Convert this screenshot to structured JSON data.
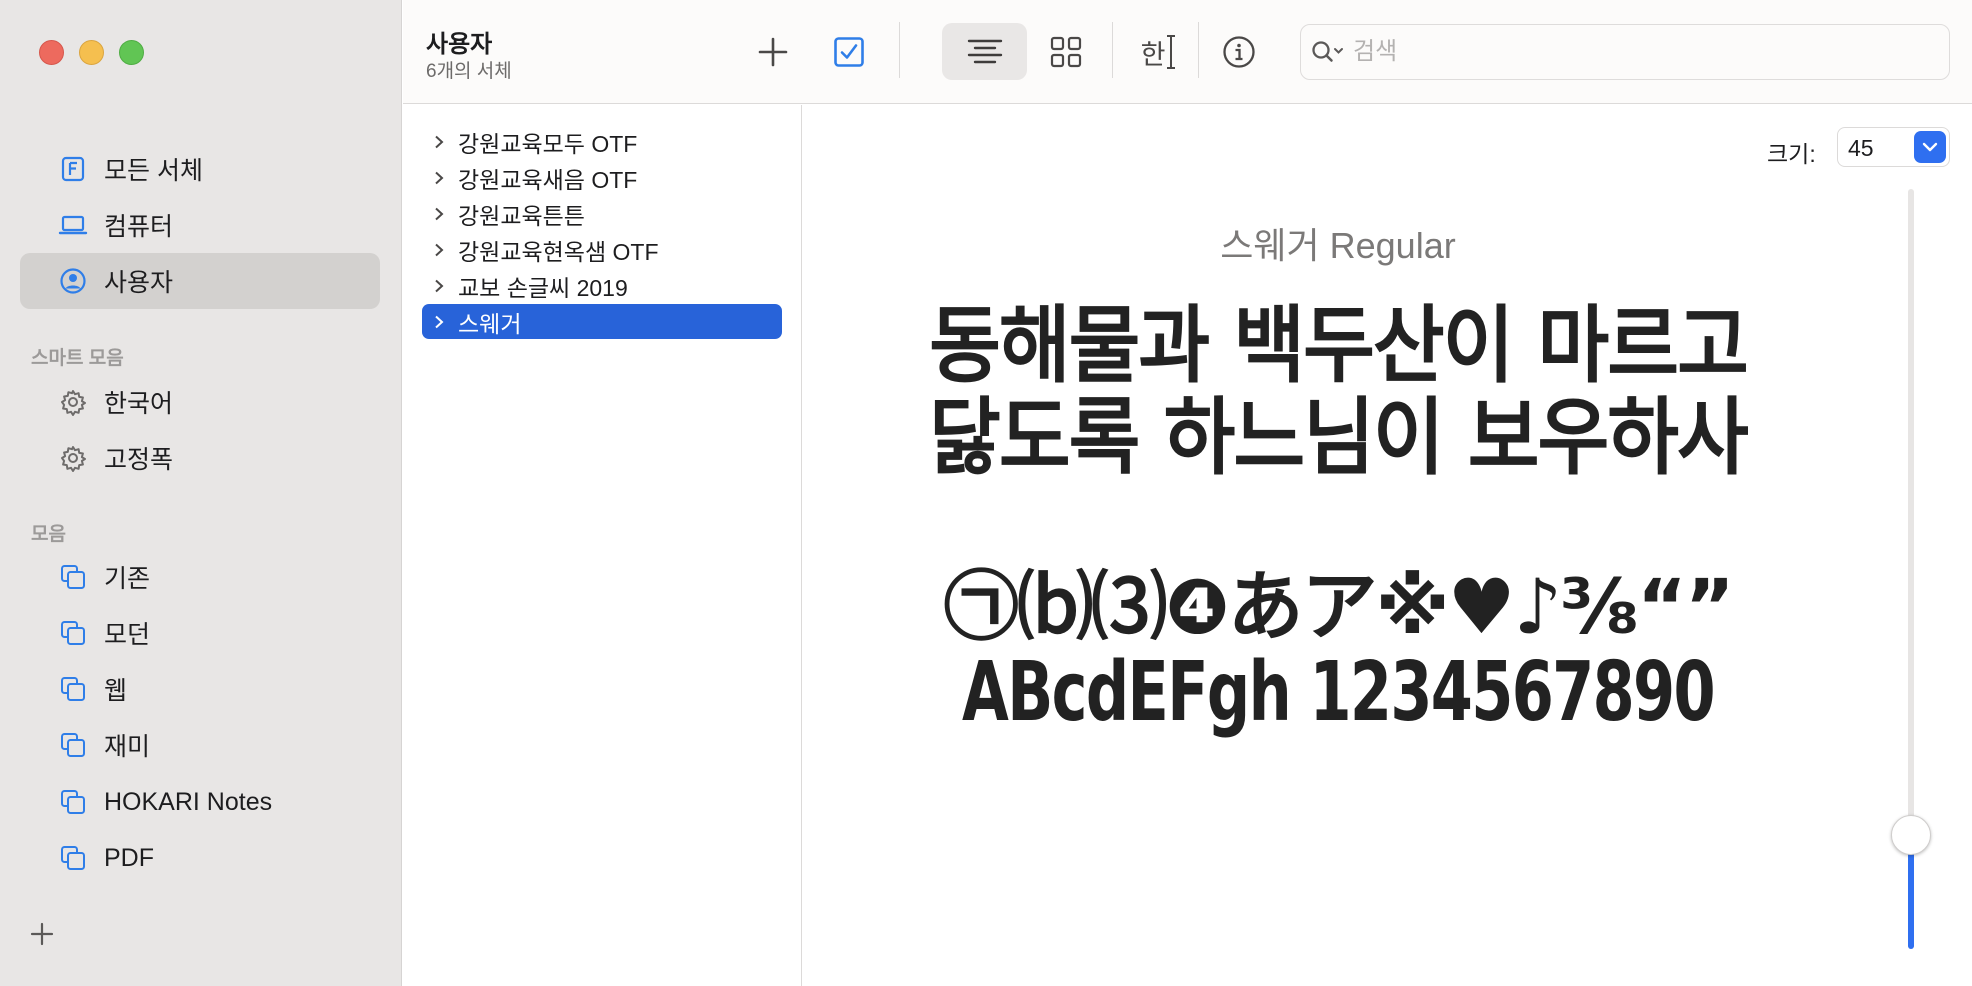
{
  "sidebar": {
    "items": [
      {
        "label": "모든 서체",
        "icon": "font-book-icon"
      },
      {
        "label": "컴퓨터",
        "icon": "laptop-icon"
      },
      {
        "label": "사용자",
        "icon": "user-circle-icon"
      }
    ],
    "smart_section": "스마트 모음",
    "smart_items": [
      {
        "label": "한국어",
        "icon": "gear-icon"
      },
      {
        "label": "고정폭",
        "icon": "gear-icon"
      }
    ],
    "collections_section": "모음",
    "collections": [
      {
        "label": "기존",
        "icon": "collection-icon"
      },
      {
        "label": "모던",
        "icon": "collection-icon"
      },
      {
        "label": "웹",
        "icon": "collection-icon"
      },
      {
        "label": "재미",
        "icon": "collection-icon"
      },
      {
        "label": "HOKARI Notes",
        "icon": "collection-icon"
      },
      {
        "label": "PDF",
        "icon": "collection-icon"
      }
    ]
  },
  "toolbar": {
    "title": "사용자",
    "subtitle": "6개의 서체",
    "search_placeholder": "검색",
    "icons": [
      "plus-icon",
      "checkbox-icon",
      "sample-view-icon",
      "grid-view-icon",
      "text-view-icon",
      "info-icon",
      "search-icon"
    ],
    "text_view_glyph": "한"
  },
  "font_list": [
    {
      "name": "강원교육모두 OTF"
    },
    {
      "name": "강원교육새음 OTF"
    },
    {
      "name": "강원교육튼튼"
    },
    {
      "name": "강원교육현옥샘 OTF"
    },
    {
      "name": "교보 손글씨 2019"
    },
    {
      "name": "스웨거"
    }
  ],
  "preview": {
    "size_label": "크기:",
    "size_value": "45",
    "slider_fraction": 0.15,
    "font_name": "스웨거 Regular",
    "sample_lines": [
      "동해물과 백두산이 마르고",
      "닳도록 하느님이 보우하사",
      "㉠⒝⑶❹あア※♥♪⅜“”",
      "ABcdEFgh 1234567890"
    ]
  },
  "colors": {
    "accent": "#2863d9",
    "sidebar_bg": "#e8e6e5",
    "selected_sidebar": "#d3d1cf",
    "icon_blue": "#2f7ee8"
  }
}
